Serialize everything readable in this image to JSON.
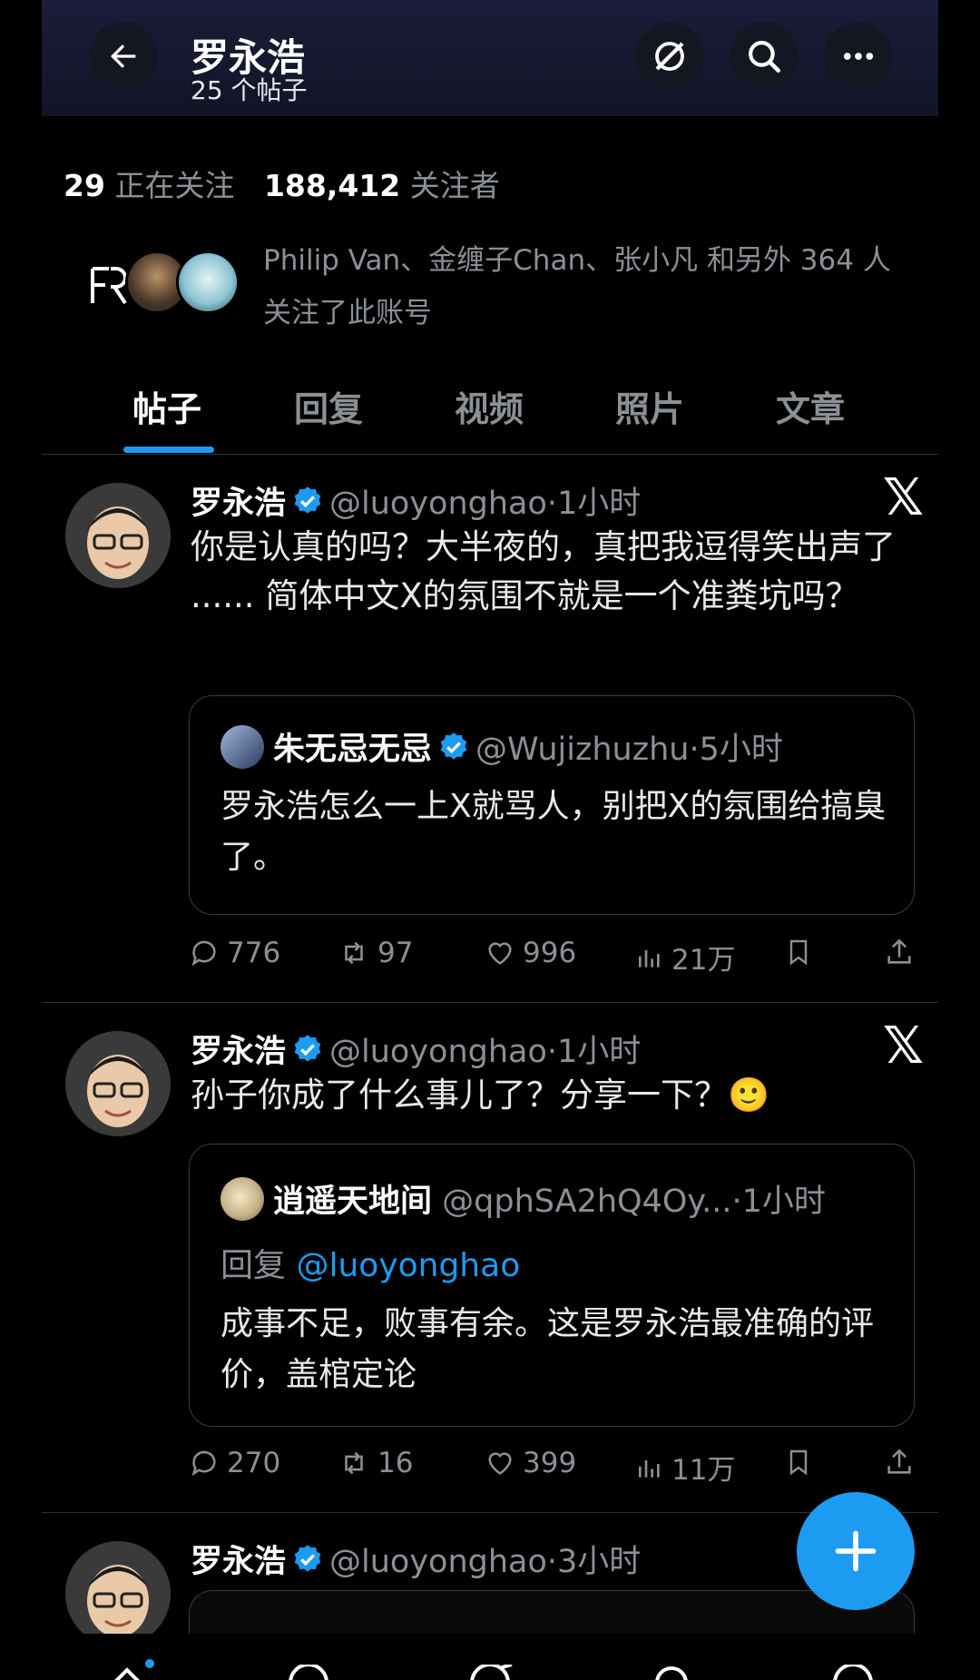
{
  "header": {
    "title": "罗永浩",
    "subtitle": "25 个帖子"
  },
  "stats": {
    "following_count": "29",
    "following_label": "正在关注",
    "followers_count": "188,412",
    "followers_label": "关注者"
  },
  "followed_by_text": "Philip Van、金缠子Chan、张小凡 和另外 364 人关注了此账号",
  "tabs": [
    "帖子",
    "回复",
    "视频",
    "照片",
    "文章"
  ],
  "posts": [
    {
      "name": "罗永浩",
      "handle": "@luoyonghao",
      "time": "·1小时",
      "text": "你是认真的吗？大半夜的，真把我逗得笑出声了 ...... 简体中文X的氛围不就是一个准粪坑吗？",
      "quote": {
        "name": "朱无忌无忌",
        "handle": "@Wujizhuzhu",
        "time": "·5小时",
        "text": "罗永浩怎么一上X就骂人，别把X的氛围给搞臭了。"
      },
      "actions": {
        "replies": "776",
        "reposts": "97",
        "likes": "996",
        "views": "21万"
      }
    },
    {
      "name": "罗永浩",
      "handle": "@luoyonghao",
      "time": "·1小时",
      "text": "孙子你成了什么事儿了？分享一下？🙂",
      "quote": {
        "name": "逍遥天地间",
        "handle": "@qphSA2hQ4Oy...",
        "time": "·1小时",
        "reply_prefix": "回复",
        "reply_mention": "@luoyonghao",
        "text": "成事不足，败事有余。这是罗永浩最准确的评价，盖棺定论"
      },
      "actions": {
        "replies": "270",
        "reposts": "16",
        "likes": "399",
        "views": "11万"
      }
    },
    {
      "name": "罗永浩",
      "handle": "@luoyonghao",
      "time": "·3小时"
    }
  ],
  "colors": {
    "accent": "#1d9bf0",
    "muted": "#8b9096",
    "background": "#000000"
  },
  "icons": [
    "back-arrow-icon",
    "grok-icon",
    "search-icon",
    "more-icon",
    "verified-icon",
    "x-logo-icon",
    "reply-icon",
    "repost-icon",
    "like-icon",
    "views-icon",
    "bookmark-icon",
    "share-icon",
    "plus-icon"
  ]
}
